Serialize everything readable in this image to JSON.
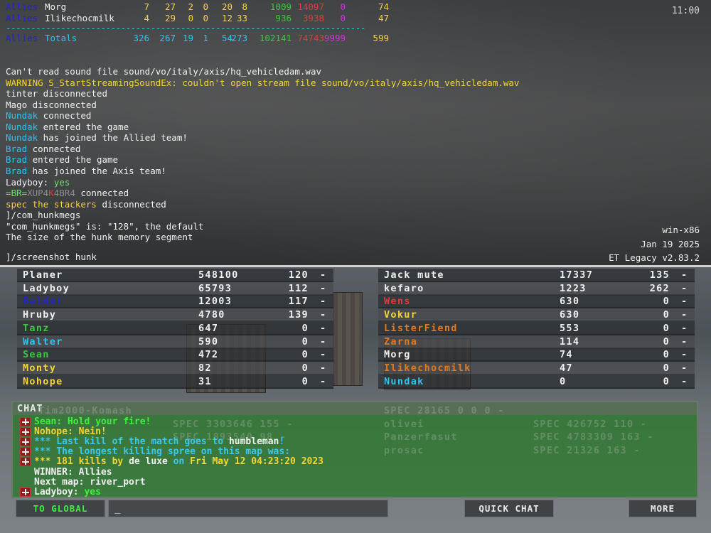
{
  "console": {
    "clock": "11:00",
    "stats": [
      {
        "team": "Allies",
        "name": "Morg",
        "cols": [
          "7",
          "27",
          "2",
          "0",
          "20",
          "8",
          "1009",
          "14097",
          "0",
          "74"
        ]
      },
      {
        "team": "Allies",
        "name": "Ilikechocmilk",
        "cols": [
          "4",
          "29",
          "0",
          "0",
          "12",
          "33",
          "936",
          "3938",
          "0",
          "47"
        ]
      }
    ],
    "dashes": "------------------------------------------------------------------------",
    "totals": {
      "team": "Allies",
      "label": "Totals",
      "cols": [
        "326",
        "267",
        "19",
        "1",
        "54",
        "273",
        "102141",
        "74743",
        "9999",
        "599"
      ]
    },
    "log": [
      [
        {
          "t": "Can't read sound file sound/vo/italy/axis/hq_vehicledam.wav",
          "c": "white"
        }
      ],
      [
        {
          "t": "WARNING S_StartStreamingSoundEx: couldn't open stream file sound/vo/italy/axis/hq_vehicledam.wav",
          "c": "yellow"
        }
      ],
      [
        {
          "t": "tinter disconnected",
          "c": "white"
        }
      ],
      [
        {
          "t": "Mago disconnected",
          "c": "white"
        }
      ],
      [
        {
          "t": "Nundak",
          "c": "cyan"
        },
        {
          "t": " connected",
          "c": "white"
        }
      ],
      [
        {
          "t": "Nundak",
          "c": "cyan"
        },
        {
          "t": " entered the game",
          "c": "white"
        }
      ],
      [
        {
          "t": "Nundak",
          "c": "cyan"
        },
        {
          "t": " has joined the Allied team!",
          "c": "white"
        }
      ],
      [
        {
          "t": "Brad",
          "c": "cyan"
        },
        {
          "t": " connected",
          "c": "white"
        }
      ],
      [
        {
          "t": "Brad",
          "c": "cyan"
        },
        {
          "t": " entered the game",
          "c": "white"
        }
      ],
      [
        {
          "t": "Brad",
          "c": "cyan"
        },
        {
          "t": " has joined the Axis team!",
          "c": "white"
        }
      ],
      [
        {
          "t": "Ladyboy: ",
          "c": "white"
        },
        {
          "t": "yes",
          "c": "lime"
        }
      ],
      [
        {
          "t": "=BR=",
          "c": "lime"
        },
        {
          "t": "XUP4",
          "c": "grey"
        },
        {
          "t": "K",
          "c": "red"
        },
        {
          "t": "4BR4",
          "c": "grey"
        },
        {
          "t": " connected",
          "c": "white"
        }
      ],
      [
        {
          "t": "spec the stackers",
          "c": "yellow"
        },
        {
          "t": " disconnected",
          "c": "white"
        }
      ],
      [
        {
          "t": "]/com_hunkmegs",
          "c": "white"
        }
      ],
      [
        {
          "t": "\"com_hunkmegs\" is: \"128\", the default",
          "c": "white"
        }
      ],
      [
        {
          "t": "The size of the hunk memory segment",
          "c": "white"
        }
      ]
    ],
    "prompt": "]/screenshot hunk",
    "version": {
      "os": "win-x86",
      "date": "Jan 19 2025",
      "name": "ET Legacy v2.83.2"
    }
  },
  "scoreboard": {
    "allies": [
      {
        "name": "Planer",
        "color": "#f0f0f0",
        "score": "548100",
        "time": "120",
        "dash": "-"
      },
      {
        "name": "Ladyboy",
        "color": "#f0f0f0",
        "score": "65793",
        "time": "112",
        "dash": "-"
      },
      {
        "name": "Balder",
        "color": "#2424c8",
        "score": "12003",
        "time": "117",
        "dash": "-"
      },
      {
        "name": "Hruby",
        "color": "#f0f0f0",
        "score": "4780",
        "time": "139",
        "dash": "-"
      },
      {
        "name": "Tanz",
        "color": "#3ec73e",
        "score": "647",
        "time": "0",
        "dash": "-"
      },
      {
        "name": "Walter",
        "color": "#2fc4ee",
        "score": "590",
        "time": "0",
        "dash": "-"
      },
      {
        "name": "Sean",
        "color": "#3ec73e",
        "score": "472",
        "time": "0",
        "dash": "-"
      },
      {
        "name": "Monty",
        "color": "#f4d533",
        "score": "82",
        "time": "0",
        "dash": "-"
      },
      {
        "name": "Nohope",
        "color": "#f4d533",
        "score": "31",
        "time": "0",
        "dash": "-"
      }
    ],
    "axis": [
      {
        "name": "Jack mute",
        "color": "#f0f0f0",
        "score": "17337",
        "time": "135",
        "dash": "-"
      },
      {
        "name": "kefaro",
        "color": "#f0f0f0",
        "score": "1223",
        "time": "262",
        "dash": "-"
      },
      {
        "name": "Wens",
        "color": "#e23a3a",
        "score": "630",
        "time": "0",
        "dash": "-"
      },
      {
        "name": "Vokur",
        "color": "#f4d533",
        "score": "630",
        "time": "0",
        "dash": "-"
      },
      {
        "name": "ListerFiend",
        "color": "#e07a20",
        "score": "553",
        "time": "0",
        "dash": "-"
      },
      {
        "name": "Zarna",
        "color": "#e07a20",
        "score": "114",
        "time": "0",
        "dash": "-"
      },
      {
        "name": "Morg",
        "color": "#f0f0f0",
        "score": "74",
        "time": "0",
        "dash": "-"
      },
      {
        "name": "Ilikechocmilk",
        "color": "#e07a20",
        "score": "47",
        "time": "0",
        "dash": "-"
      },
      {
        "name": "Nundak",
        "color": "#2fc4ee",
        "score": "0",
        "time": "0",
        "dash": "-"
      }
    ]
  },
  "chat": {
    "title": "CHAT",
    "ghost_rows": [
      {
        "left": "Tim2000-Komash",
        "right": "SPEC 28165 0 0 0 -"
      },
      {
        "left": "SPEC 3303646 155 -",
        "right": "olivei",
        "mid": "SPEC 426752 110 -"
      },
      {
        "left": "SPEC 1893540 98 -",
        "right": "Panzerfasut",
        "mid": "SPEC 4783309 163 -"
      },
      {
        "left": "",
        "right": "prosac",
        "mid": "SPEC 21326 163 -"
      }
    ],
    "lines": [
      {
        "icon": true,
        "parts": [
          {
            "t": "Sean: Hold your fire!",
            "c": "#3ef03e"
          }
        ]
      },
      {
        "icon": true,
        "parts": [
          {
            "t": "Nohope: Nein!",
            "c": "#f4d533"
          }
        ]
      },
      {
        "icon": true,
        "parts": [
          {
            "t": "*** Last kill of the match goes to ",
            "c": "#3ac8ee"
          },
          {
            "t": "humbleman",
            "c": "#f0f0f0"
          },
          {
            "t": "!",
            "c": "#3ac8ee"
          }
        ]
      },
      {
        "icon": true,
        "parts": [
          {
            "t": "*** The longest killing spree on this map was:",
            "c": "#3ac8ee"
          }
        ]
      },
      {
        "icon": true,
        "parts": [
          {
            "t": "*** 181 kills by ",
            "c": "#f4d533"
          },
          {
            "t": "de luxe",
            "c": "#f0f0f0"
          },
          {
            "t": " on ",
            "c": "#3ac8ee"
          },
          {
            "t": "Fri May 12 04:23:20 2023",
            "c": "#f4d533"
          }
        ]
      },
      {
        "icon": false,
        "parts": [
          {
            "t": "WINNER: Allies",
            "c": "#f0f0f0"
          }
        ]
      },
      {
        "icon": false,
        "parts": [
          {
            "t": "Next map: river_port",
            "c": "#f0f0f0"
          }
        ]
      },
      {
        "icon": true,
        "parts": [
          {
            "t": "Ladyboy: ",
            "c": "#f0f0f0"
          },
          {
            "t": "yes",
            "c": "#3ef03e"
          }
        ]
      }
    ]
  },
  "inputbar": {
    "to_global": "TO GLOBAL",
    "input_value": "_",
    "quick_chat": "QUICK CHAT",
    "more": "MORE"
  },
  "colors": {
    "chat_bg": "#2c782c",
    "console_cyan": "#2fc4ee",
    "accent_yellow": "#f4d533"
  }
}
